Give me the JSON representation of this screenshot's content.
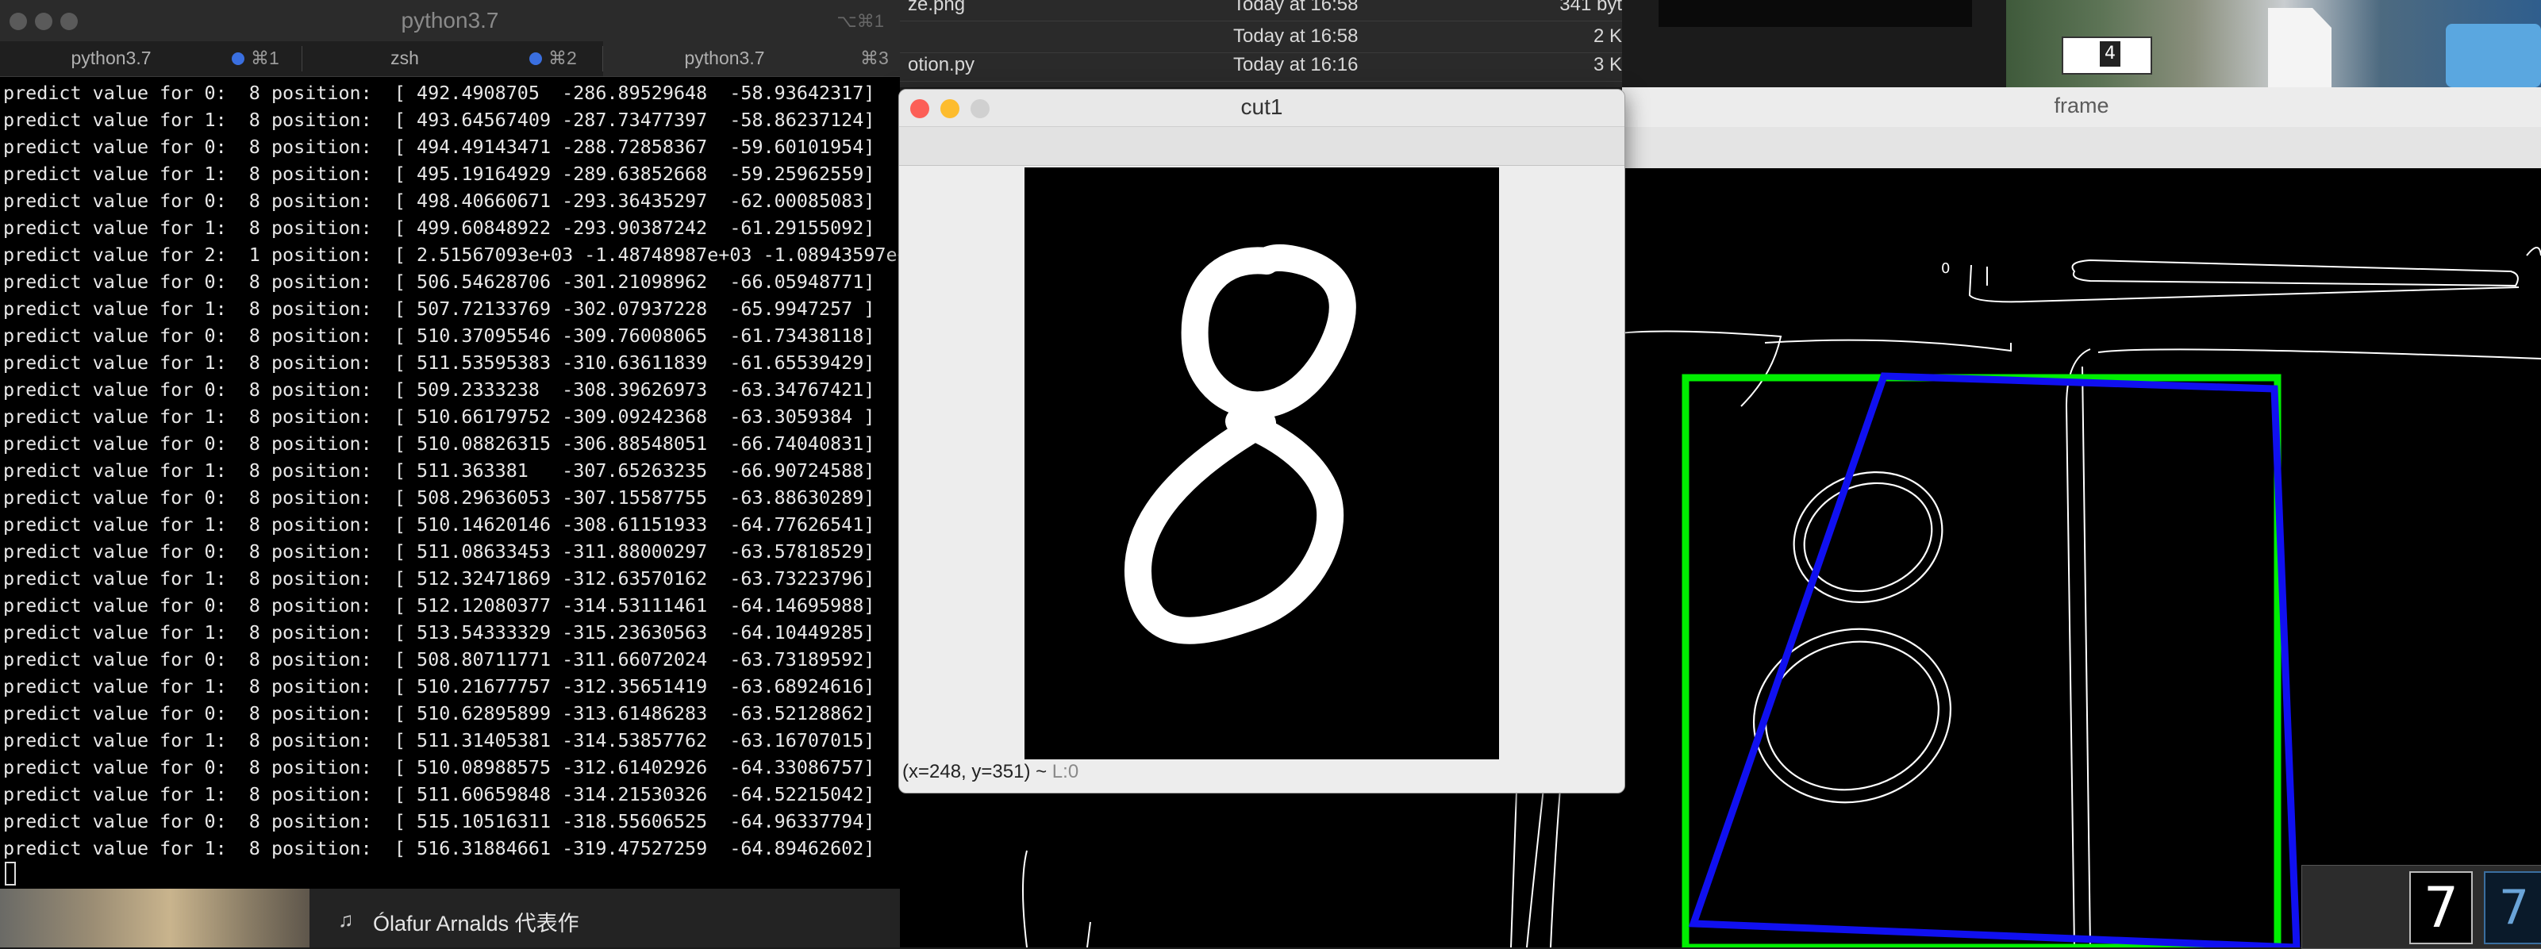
{
  "terminal": {
    "title": "python3.7",
    "title_shortcut": "⌥⌘1",
    "tabs": [
      {
        "label": "python3.7",
        "shortcut": "⌘1",
        "active": false
      },
      {
        "label": "zsh",
        "shortcut": "⌘2",
        "active": false
      },
      {
        "label": "python3.7",
        "shortcut": "⌘3",
        "active": true
      }
    ],
    "new_tab_icon": "plus-icon",
    "lines": [
      "predict value for 0:  8 position:  [ 492.4908705  -286.89529648  -58.93642317]",
      "predict value for 1:  8 position:  [ 493.64567409 -287.73477397  -58.86237124]",
      "predict value for 0:  8 position:  [ 494.49143471 -288.72858367  -59.60101954]",
      "predict value for 1:  8 position:  [ 495.19164929 -289.63852668  -59.25962559]",
      "predict value for 0:  8 position:  [ 498.40660671 -293.36435297  -62.00085083]",
      "predict value for 1:  8 position:  [ 499.60848922 -293.90387242  -61.29155092]",
      "predict value for 2:  1 position:  [ 2.51567093e+03 -1.48748987e+03 -1.08943597e+",
      "predict value for 0:  8 position:  [ 506.54628706 -301.21098962  -66.05948771]",
      "predict value for 1:  8 position:  [ 507.72133769 -302.07937228  -65.9947257 ]",
      "predict value for 0:  8 position:  [ 510.37095546 -309.76008065  -61.73438118]",
      "predict value for 1:  8 position:  [ 511.53595383 -310.63611839  -61.65539429]",
      "predict value for 0:  8 position:  [ 509.2333238  -308.39626973  -63.34767421]",
      "predict value for 1:  8 position:  [ 510.66179752 -309.09242368  -63.3059384 ]",
      "predict value for 0:  8 position:  [ 510.08826315 -306.88548051  -66.74040831]",
      "predict value for 1:  8 position:  [ 511.363381   -307.65263235  -66.90724588]",
      "predict value for 0:  8 position:  [ 508.29636053 -307.15587755  -63.88630289]",
      "predict value for 1:  8 position:  [ 510.14620146 -308.61151933  -64.77626541]",
      "predict value for 0:  8 position:  [ 511.08633453 -311.88000297  -63.57818529]",
      "predict value for 1:  8 position:  [ 512.32471869 -312.63570162  -63.73223796]",
      "predict value for 0:  8 position:  [ 512.12080377 -314.53111461  -64.14695988]",
      "predict value for 1:  8 position:  [ 513.54333329 -315.23630563  -64.10449285]",
      "predict value for 0:  8 position:  [ 508.80711771 -311.66072024  -63.73189592]",
      "predict value for 1:  8 position:  [ 510.21677757 -312.35651419  -63.68924616]",
      "predict value for 0:  8 position:  [ 510.62895899 -313.61486283  -63.52128862]",
      "predict value for 1:  8 position:  [ 511.31405381 -314.53857762  -63.16707015]",
      "predict value for 0:  8 position:  [ 510.08988575 -312.61402926  -64.33086757]",
      "predict value for 1:  8 position:  [ 511.60659848 -314.21530326  -64.52215042]",
      "predict value for 0:  8 position:  [ 515.10516311 -318.55606525  -64.96337794]",
      "predict value for 1:  8 position:  [ 516.31884661 -319.47527259  -64.89462602]"
    ]
  },
  "now_playing": {
    "icon": "music-note-icon",
    "text": "Ólafur Arnalds 代表作"
  },
  "finder": {
    "rows": [
      {
        "name": "ze.png",
        "date": "Today at 16:58",
        "size": "341 byt"
      },
      {
        "name": "",
        "date": "Today at 16:58",
        "size": "2 K"
      },
      {
        "name": "otion.py",
        "date": "Today at 16:16",
        "size": "3 K"
      }
    ]
  },
  "cut1": {
    "title": "cut1",
    "status_coords": "(x=248, y=351) ~ ",
    "status_level": "L:0",
    "digit": "8"
  },
  "frame": {
    "title": "frame",
    "detected_label": "0",
    "colors": {
      "green_box": "#00ee00",
      "blue_box": "#1010f0",
      "edges": "#ffffff"
    }
  },
  "desktop": {
    "thumb_digit": "4",
    "mini_digit": "7",
    "mini_digit2": "7"
  },
  "colors": {
    "terminal_bg": "#000000",
    "terminal_text": "#e8e8e8",
    "tab_dot": "#3a6fe0",
    "mac_close": "#fc5f57",
    "mac_minimize": "#fdbc2e",
    "mac_zoom": "#cfcfcf"
  }
}
